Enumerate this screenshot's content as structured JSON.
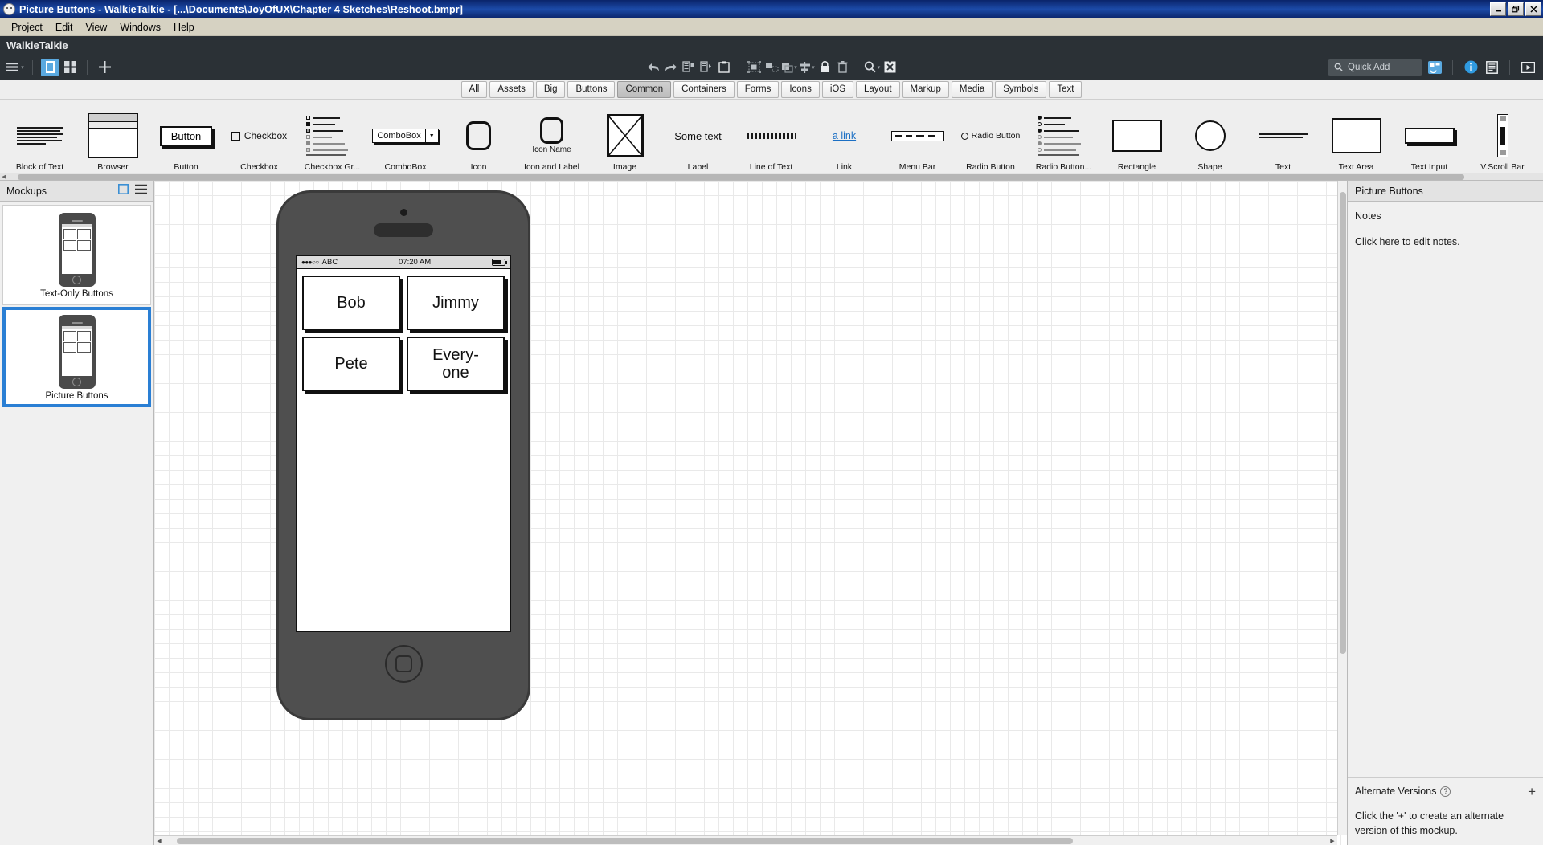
{
  "window": {
    "title": "Picture Buttons - WalkieTalkie - [...\\Documents\\JoyOfUX\\Chapter 4 Sketches\\Reshoot.bmpr]",
    "app_icon": "balsamiq-smiley-icon",
    "minimize": "_",
    "restore": "❐",
    "close": "✕"
  },
  "menubar": {
    "items": [
      {
        "label": "Project"
      },
      {
        "label": "Edit"
      },
      {
        "label": "View"
      },
      {
        "label": "Windows"
      },
      {
        "label": "Help"
      }
    ]
  },
  "toolbar": {
    "project_name": "WalkieTalkie",
    "left_icons": [
      {
        "name": "hamburger-menu-icon",
        "active": false
      },
      {
        "name": "single-panel-view-icon",
        "active": true
      },
      {
        "name": "grid-view-icon",
        "active": false
      },
      {
        "name": "add-new-icon",
        "active": false
      }
    ],
    "center_icons": [
      {
        "name": "undo-icon"
      },
      {
        "name": "redo-icon"
      },
      {
        "name": "duplicate-icon"
      },
      {
        "name": "copy-to-icon"
      },
      {
        "name": "paste-icon"
      },
      {
        "name": "group-icon"
      },
      {
        "name": "ungroup-icon"
      },
      {
        "name": "bring-forward-icon"
      },
      {
        "name": "align-icon"
      },
      {
        "name": "lock-icon"
      },
      {
        "name": "delete-icon"
      },
      {
        "name": "zoom-icon"
      },
      {
        "name": "reset-zoom-icon"
      }
    ],
    "quick_add": {
      "placeholder": "Quick Add",
      "icon": "search-icon"
    },
    "right_icons": [
      {
        "name": "ui-library-icon",
        "active": true
      },
      {
        "name": "info-icon"
      },
      {
        "name": "notes-panel-icon"
      },
      {
        "name": "presentation-play-icon"
      }
    ]
  },
  "categories": {
    "selected": "Common",
    "items": [
      "All",
      "Assets",
      "Big",
      "Buttons",
      "Common",
      "Containers",
      "Forms",
      "Icons",
      "iOS",
      "Layout",
      "Markup",
      "Media",
      "Symbols",
      "Text"
    ]
  },
  "palette": {
    "items": [
      {
        "label": "Block of Text",
        "thumb": "text-block-thumb"
      },
      {
        "label": "Browser",
        "thumb": "browser-window-thumb"
      },
      {
        "label": "Button",
        "thumb": "button-thumb",
        "text": "Button"
      },
      {
        "label": "Checkbox",
        "thumb": "checkbox-thumb",
        "text": "Checkbox"
      },
      {
        "label": "Checkbox Gr...",
        "thumb": "checkbox-group-thumb"
      },
      {
        "label": "ComboBox",
        "thumb": "combobox-thumb",
        "text": "ComboBox"
      },
      {
        "label": "Icon",
        "thumb": "icon-thumb"
      },
      {
        "label": "Icon and Label",
        "thumb": "icon-label-thumb",
        "text": "Icon Name"
      },
      {
        "label": "Image",
        "thumb": "image-placeholder-thumb"
      },
      {
        "label": "Label",
        "thumb": "label-thumb",
        "text": "Some text"
      },
      {
        "label": "Line of Text",
        "thumb": "line-of-text-thumb"
      },
      {
        "label": "Link",
        "thumb": "link-thumb",
        "text": "a link"
      },
      {
        "label": "Menu Bar",
        "thumb": "menubar-thumb"
      },
      {
        "label": "Radio Button",
        "thumb": "radio-button-thumb",
        "text": "Radio Button"
      },
      {
        "label": "Radio Button...",
        "thumb": "radio-group-thumb"
      },
      {
        "label": "Rectangle",
        "thumb": "rectangle-thumb"
      },
      {
        "label": "Shape",
        "thumb": "shape-circle-thumb"
      },
      {
        "label": "Text",
        "thumb": "text-thumb"
      },
      {
        "label": "Text Area",
        "thumb": "textarea-thumb"
      },
      {
        "label": "Text Input",
        "thumb": "text-input-thumb"
      },
      {
        "label": "V.Scroll Bar",
        "thumb": "vscrollbar-thumb"
      }
    ]
  },
  "sidebar": {
    "title": "Mockups",
    "header_icons": [
      {
        "name": "new-mockup-icon"
      },
      {
        "name": "sidebar-menu-icon"
      }
    ],
    "mockups": [
      {
        "label": "Text-Only Buttons",
        "selected": false
      },
      {
        "label": "Picture Buttons",
        "selected": true
      }
    ]
  },
  "canvas": {
    "phone": {
      "status_bar": {
        "signal": "●●●○○",
        "carrier": "ABC",
        "time": "07:20 AM",
        "battery": "battery-icon"
      },
      "buttons": [
        {
          "label": "Bob"
        },
        {
          "label": "Jimmy"
        },
        {
          "label": "Pete"
        },
        {
          "label": "Every-\none"
        }
      ]
    }
  },
  "rightpanel": {
    "title": "Picture Buttons",
    "notes_label": "Notes",
    "notes_placeholder": "Click here to edit notes.",
    "alternate_versions": {
      "title": "Alternate Versions",
      "help_icon": "?",
      "add_icon": "+",
      "description": "Click the '+' to create an alternate version of this mockup."
    }
  },
  "colors": {
    "titlebar": "#0a246a",
    "dark_toolbar": "#2b3136",
    "accent_blue": "#2a7fd4",
    "icon_blue": "#5aa9e0"
  }
}
